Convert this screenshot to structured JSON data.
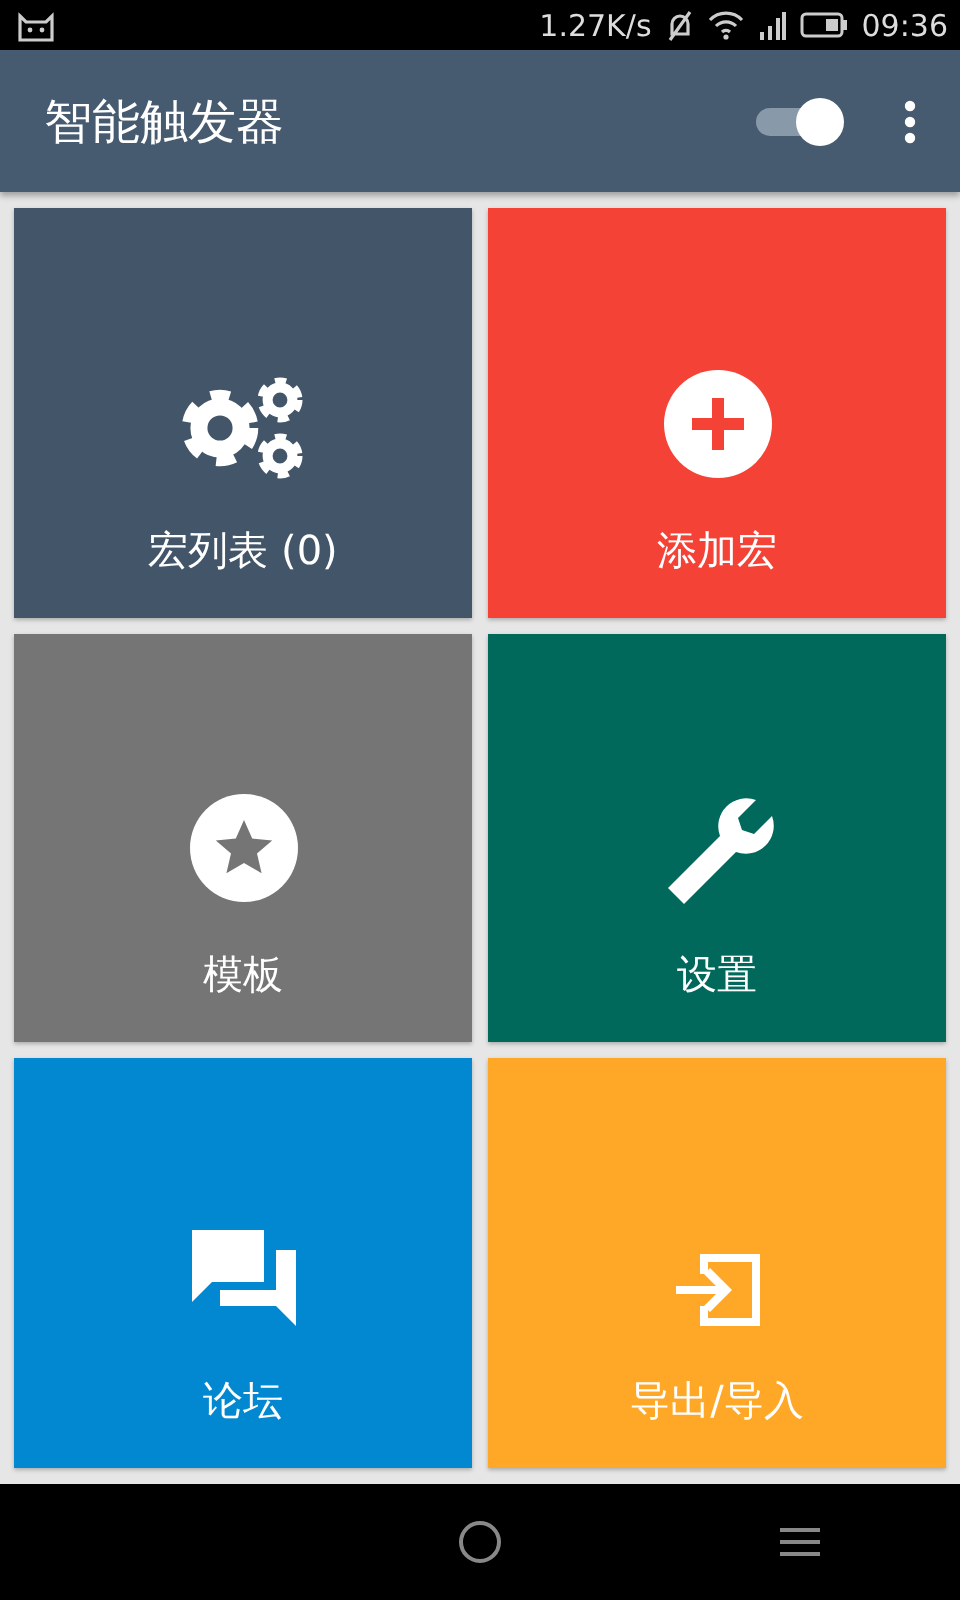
{
  "status_bar": {
    "speed": "1.27K/s",
    "time": "09:36"
  },
  "app_bar": {
    "title": "智能触发器",
    "switch": {
      "on": true
    }
  },
  "tiles": [
    {
      "label": "宏列表 (0)",
      "kind": "gears",
      "color": "#435569"
    },
    {
      "label": "添加宏",
      "kind": "add",
      "color": "#f44336"
    },
    {
      "label": "模板",
      "kind": "star",
      "color": "#757575"
    },
    {
      "label": "设置",
      "kind": "wrench",
      "color": "#00695c"
    },
    {
      "label": "论坛",
      "kind": "chat",
      "color": "#0288d1"
    },
    {
      "label": "导出/导入",
      "kind": "import",
      "color": "#ffa726"
    }
  ]
}
